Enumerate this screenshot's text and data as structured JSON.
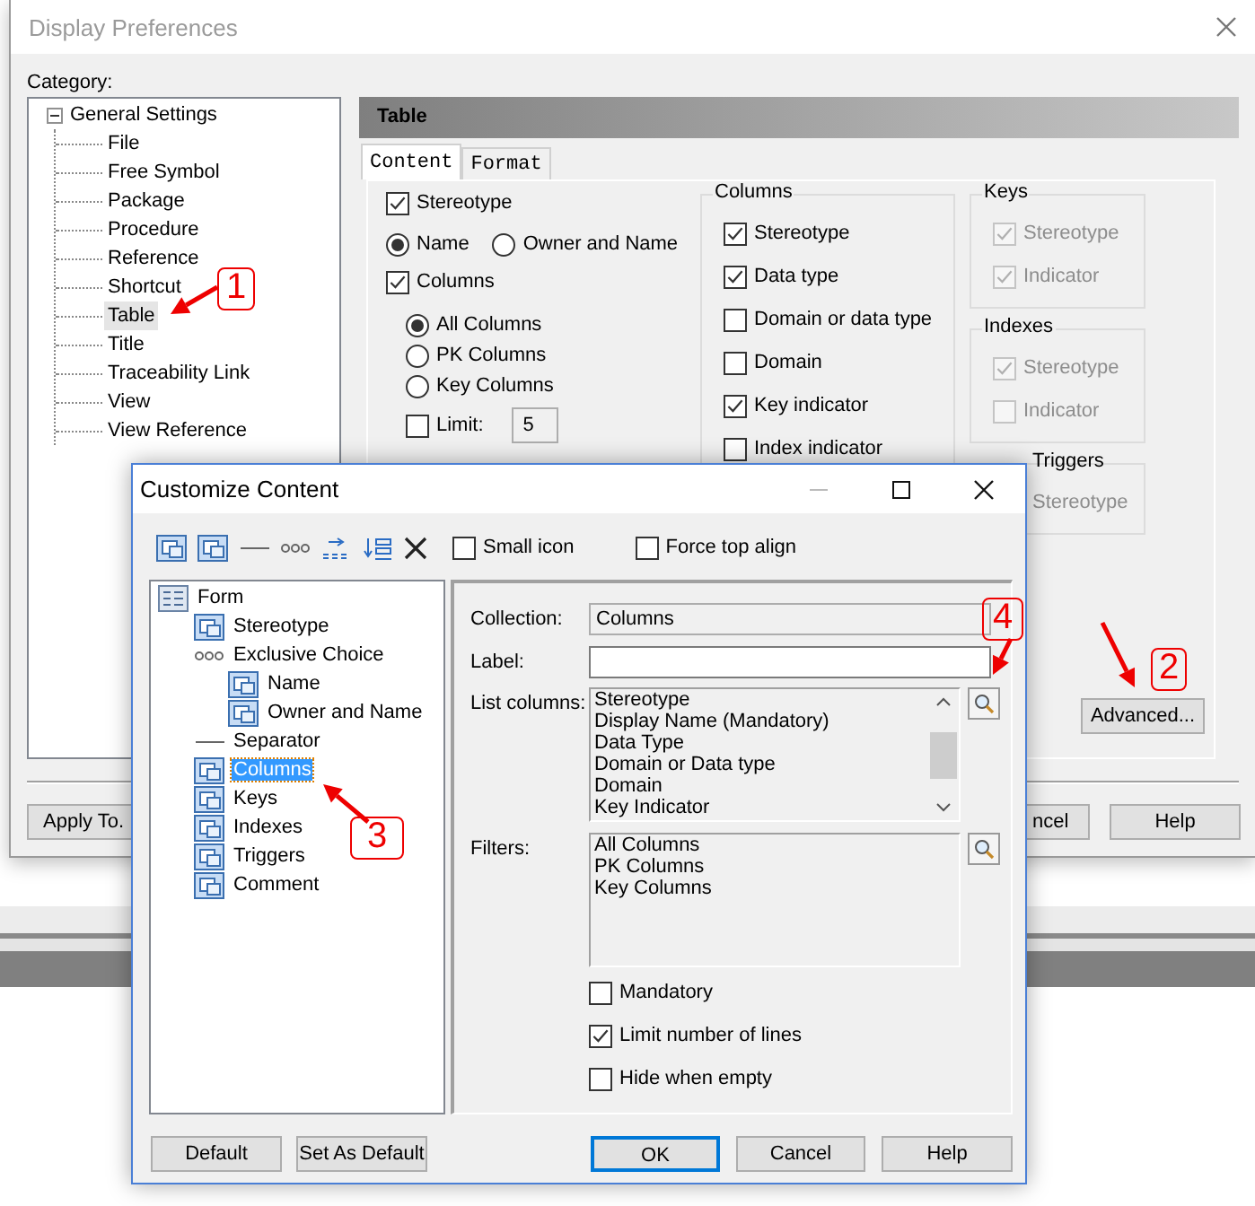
{
  "background_window": {
    "title": "Display Preferences",
    "category_label": "Category:",
    "tree": [
      {
        "label": "General Settings",
        "expanded": true,
        "selected": false,
        "children": [
          {
            "label": "File",
            "selected": false
          },
          {
            "label": "Free Symbol",
            "selected": false
          },
          {
            "label": "Package",
            "selected": false
          },
          {
            "label": "Procedure",
            "selected": false
          },
          {
            "label": "Reference",
            "selected": false
          },
          {
            "label": "Shortcut",
            "selected": false
          },
          {
            "label": "Table",
            "selected": true
          },
          {
            "label": "Title",
            "selected": false
          },
          {
            "label": "Traceability Link",
            "selected": false
          },
          {
            "label": "View",
            "selected": false
          },
          {
            "label": "View Reference",
            "selected": false
          }
        ]
      }
    ],
    "panel_title": "Table",
    "tabs": [
      {
        "label": "Content",
        "selected": true
      },
      {
        "label": "Format",
        "selected": false
      }
    ],
    "options": [
      {
        "kind": "checkbox",
        "label": "Stereotype",
        "checked": true
      },
      {
        "kind": "radios",
        "items": [
          {
            "label": "Name",
            "selected": true
          },
          {
            "label": "Owner and Name",
            "selected": false
          }
        ]
      },
      {
        "kind": "checkbox",
        "label": "Columns",
        "checked": true,
        "children": [
          {
            "kind": "radio",
            "label": "All Columns",
            "selected": true
          },
          {
            "kind": "radio",
            "label": "PK Columns",
            "selected": false
          },
          {
            "kind": "radio",
            "label": "Key Columns",
            "selected": false
          },
          {
            "kind": "limit",
            "label": "Limit:",
            "checked": false,
            "value": "5"
          }
        ]
      }
    ],
    "groups": [
      {
        "title": "Columns",
        "disabled": false,
        "items": [
          {
            "label": "Stereotype",
            "checked": true
          },
          {
            "label": "Data type",
            "checked": true
          },
          {
            "label": "Domain or data type",
            "checked": false
          },
          {
            "label": "Domain",
            "checked": false
          },
          {
            "label": "Key indicator",
            "checked": true
          },
          {
            "label": "Index indicator",
            "checked": false
          }
        ]
      },
      {
        "title": "Keys",
        "disabled": true,
        "items": [
          {
            "label": "Stereotype",
            "checked": true
          },
          {
            "label": "Indicator",
            "checked": true
          }
        ]
      },
      {
        "title": "Indexes",
        "disabled": true,
        "items": [
          {
            "label": "Stereotype",
            "checked": true
          },
          {
            "label": "Indicator",
            "checked": false
          }
        ]
      },
      {
        "title": "Triggers",
        "disabled": true,
        "items": [
          {
            "label": "Stereotype"
          }
        ]
      }
    ],
    "advanced_button": "Advanced...",
    "buttons": [
      {
        "label": "Apply To."
      },
      {
        "label": "ncel"
      },
      {
        "label": "Help"
      }
    ]
  },
  "dialog": {
    "title": "Customize Content",
    "toolbar_checkboxes": [
      {
        "label": "Small icon",
        "checked": false
      },
      {
        "label": "Force top align",
        "checked": false
      }
    ],
    "tree": [
      {
        "label": "Form",
        "kind": "form",
        "selected": false,
        "children": [
          {
            "label": "Stereotype",
            "kind": "control",
            "selected": false
          },
          {
            "label": "Exclusive Choice",
            "kind": "choice",
            "selected": false,
            "children": [
              {
                "label": "Name",
                "kind": "control",
                "selected": false
              },
              {
                "label": "Owner and Name",
                "kind": "control",
                "selected": false
              }
            ]
          },
          {
            "label": "Separator",
            "kind": "separator",
            "selected": false
          },
          {
            "label": "Columns",
            "kind": "control",
            "selected": true
          },
          {
            "label": "Keys",
            "kind": "control",
            "selected": false
          },
          {
            "label": "Indexes",
            "kind": "control",
            "selected": false
          },
          {
            "label": "Triggers",
            "kind": "control",
            "selected": false
          },
          {
            "label": "Comment",
            "kind": "control",
            "selected": false
          }
        ]
      }
    ],
    "collection": {
      "label": "Collection:",
      "value": "Columns"
    },
    "label_field": {
      "label": "Label:"
    },
    "list_columns": {
      "label": "List columns:",
      "items": [
        "Stereotype",
        "Display Name (Mandatory)",
        "Data Type",
        "Domain or Data type",
        "Domain",
        "Key Indicator"
      ]
    },
    "filters": {
      "label": "Filters:",
      "items": [
        "All Columns",
        "PK Columns",
        "Key Columns"
      ]
    },
    "options": [
      {
        "label": "Mandatory",
        "checked": false
      },
      {
        "label": "Limit number of lines",
        "checked": true
      },
      {
        "label": "Hide when empty",
        "checked": false
      }
    ],
    "buttons": [
      {
        "label": "Default",
        "default": false
      },
      {
        "label": "Set As Default",
        "default": false
      },
      {
        "label": "OK",
        "default": true
      },
      {
        "label": "Cancel",
        "default": false
      },
      {
        "label": "Help",
        "default": false
      }
    ]
  },
  "annotations": [
    {
      "label": "1"
    },
    {
      "label": "2"
    },
    {
      "label": "3"
    },
    {
      "label": "4"
    }
  ]
}
